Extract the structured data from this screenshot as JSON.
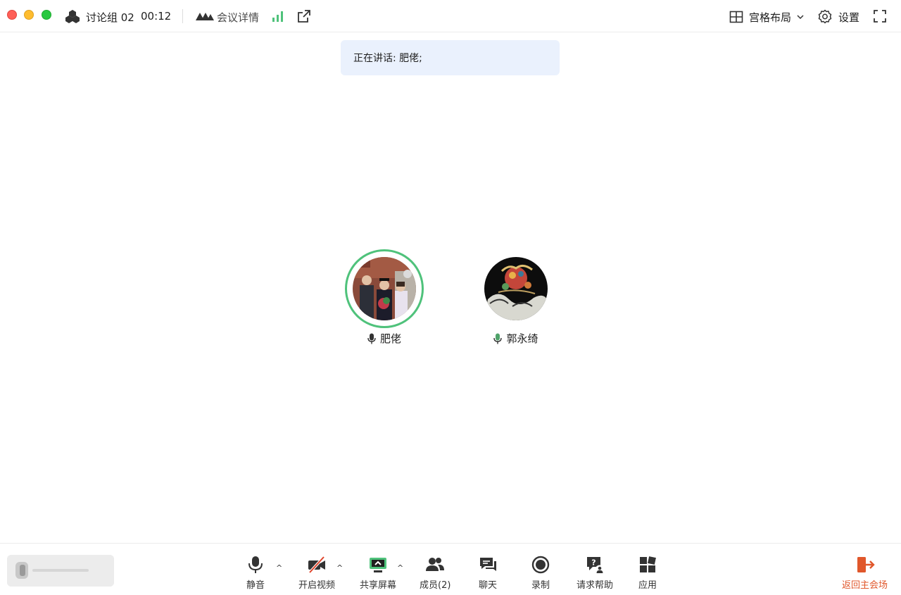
{
  "window": {
    "group_title": "讨论组 02",
    "timer": "00:12",
    "details_label": "会议详情",
    "layout_label": "宫格布局",
    "settings_label": "设置"
  },
  "banner": {
    "speaking_text": "正在讲话: 肥佬;"
  },
  "participants": [
    {
      "name": "肥佬",
      "speaking": true,
      "mic_color": "#333333"
    },
    {
      "name": "郭永绮",
      "speaking": false,
      "mic_color": "#4fa36a"
    }
  ],
  "toolbar": {
    "mute_label": "静音",
    "video_label": "开启视频",
    "share_label": "共享屏幕",
    "members_label": "成员(2)",
    "chat_label": "聊天",
    "record_label": "录制",
    "help_label": "请求帮助",
    "apps_label": "应用",
    "leave_label": "返回主会场"
  },
  "colors": {
    "accent_green": "#4fc27b",
    "banner_bg": "#eaf1fd",
    "leave_red": "#e0572b"
  }
}
